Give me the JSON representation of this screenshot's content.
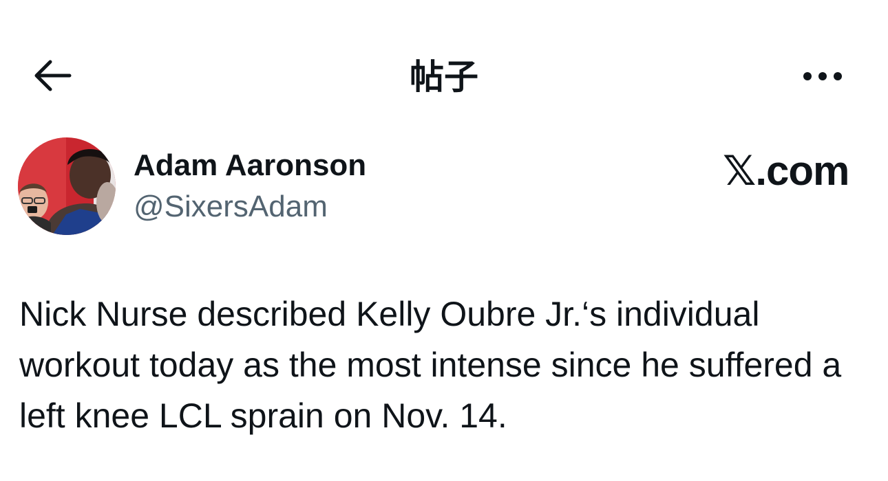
{
  "header": {
    "title": "帖子",
    "back_icon": "arrow-left-icon",
    "more_icon": "more-horizontal-icon"
  },
  "post": {
    "author_name": "Adam Aaronson",
    "author_handle": "@SixersAdam",
    "site_mark": "𝕏.com",
    "text": "Nick Nurse described Kelly Oubre Jr.‘s individual workout today as the most intense since he suffered a left knee LCL sprain on Nov. 14."
  },
  "colors": {
    "text_primary": "#0f1419",
    "text_secondary": "#536471",
    "background": "#ffffff"
  }
}
